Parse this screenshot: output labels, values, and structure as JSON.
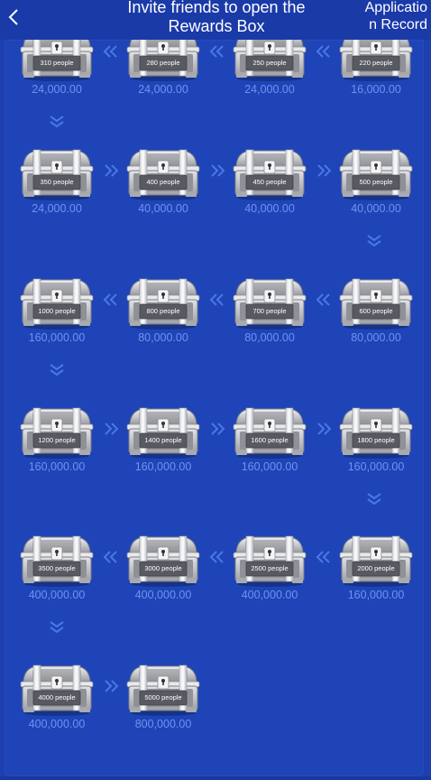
{
  "header": {
    "title": "Invite friends to open the Rewards Box",
    "record_label": "Application Record",
    "back_icon": "chevron-left-icon"
  },
  "colors": {
    "background": "#1d3fb0",
    "header": "#1a3aa8",
    "amount_text": "#6f93ee",
    "arrow": "#4a78e6",
    "chest_silver": "#c9cbd0"
  },
  "rows": [
    {
      "direction": "left",
      "chests": [
        {
          "people": "310 people",
          "amount": "24,000.00"
        },
        {
          "people": "280 people",
          "amount": "24,000.00"
        },
        {
          "people": "250 people",
          "amount": "24,000.00"
        },
        {
          "people": "220 people",
          "amount": "16,000.00"
        }
      ]
    },
    {
      "direction": "right",
      "chests": [
        {
          "people": "350 people",
          "amount": "24,000.00"
        },
        {
          "people": "400 people",
          "amount": "40,000.00"
        },
        {
          "people": "450 people",
          "amount": "40,000.00"
        },
        {
          "people": "500 people",
          "amount": "40,000.00"
        }
      ]
    },
    {
      "direction": "left",
      "chests": [
        {
          "people": "1000 people",
          "amount": "160,000.00"
        },
        {
          "people": "800 people",
          "amount": "80,000.00"
        },
        {
          "people": "700 people",
          "amount": "80,000.00"
        },
        {
          "people": "600 people",
          "amount": "80,000.00"
        }
      ]
    },
    {
      "direction": "right",
      "chests": [
        {
          "people": "1200 people",
          "amount": "160,000.00"
        },
        {
          "people": "1400 people",
          "amount": "160,000.00"
        },
        {
          "people": "1600 people",
          "amount": "160,000.00"
        },
        {
          "people": "1800 people",
          "amount": "160,000.00"
        }
      ]
    },
    {
      "direction": "left",
      "chests": [
        {
          "people": "3500 people",
          "amount": "400,000.00"
        },
        {
          "people": "3000 people",
          "amount": "400,000.00"
        },
        {
          "people": "2500 people",
          "amount": "400,000.00"
        },
        {
          "people": "2000 people",
          "amount": "160,000.00"
        }
      ]
    },
    {
      "direction": "right",
      "chests": [
        {
          "people": "4000 people",
          "amount": "400,000.00"
        },
        {
          "people": "5000 people",
          "amount": "800,000.00"
        }
      ]
    }
  ]
}
